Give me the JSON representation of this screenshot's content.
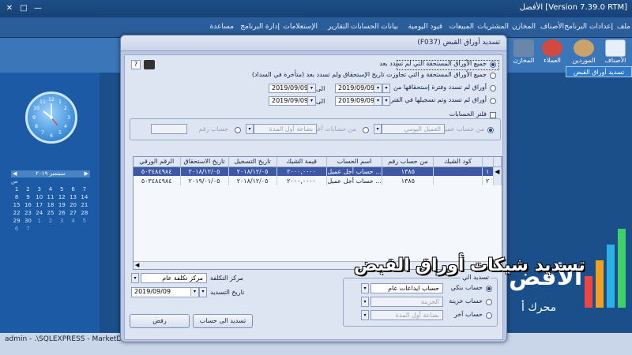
{
  "app": {
    "title": "[Version 7.39.0 RTM] الأفضل",
    "menu": [
      "ملف",
      "إعدادات البرنامج",
      "الأصناف",
      "المخازن",
      "المشتريات",
      "المبيعات",
      "قيود اليومية",
      "بيانات الحسابات",
      "التقارير",
      "الإستعلامات",
      "إدارة البرنامج",
      "مساعدة"
    ],
    "toolbar": [
      "الأصناف",
      "الموردين",
      "العملاء",
      "المخازن"
    ],
    "nav_tab": "تسديد أوراق القبض",
    "status": "admin  -  .\\SQLEXPRESS  -  MarketDB"
  },
  "calendar": {
    "header": "سبتمبر ٢٠١٩",
    "weekday_header": "س",
    "days": [
      "1",
      "2",
      "3",
      "4",
      "5",
      "6",
      "7",
      "8",
      "9",
      "10",
      "11",
      "12",
      "13",
      "14",
      "15",
      "16",
      "17",
      "18",
      "19",
      "20",
      "21",
      "22",
      "23",
      "24",
      "25",
      "26",
      "27",
      "28",
      "29",
      "30",
      "1",
      "2",
      "3",
      "4",
      "5",
      "6",
      "7"
    ]
  },
  "brand": {
    "logo_text": "الأفض",
    "sub_text": "محرك أ"
  },
  "dialog": {
    "title": "تسديد أوراق القبض  (F037)",
    "options": {
      "opt1": "جميع الأوراق المستحقة التي لم تسدد بعد",
      "opt2": "جميع الأوراق المستحقة و التي تجاوزت تاريخ الإستحقاق ولم تسدد بعد (متأخرة في السداد)",
      "opt3": "أوراق لم تسدد وفترة إستحقاقها من",
      "opt4": "أوراق لم تسدد وتم تسجيلها في الفترة من",
      "to_label": "الى",
      "from_date_1": "2019/09/09",
      "to_date_1": "2019/09/09",
      "from_date_2": "2019/09/09",
      "to_date_2": "2019/09/09"
    },
    "filter": {
      "checkbox_label": "فلتر الحسابات",
      "radio_customer": "من حساب عميل",
      "customer_value": "العميل اليومي",
      "radio_other": "من حسابات أخرى",
      "other_value": "بضاعة أول المدة",
      "radio_account_no": "حساب رقم",
      "account_no_value": ""
    },
    "table": {
      "headers": [
        "",
        "",
        "كود الشيك",
        "من حساب رقم",
        "اسم الحساب",
        "قيمة الشيك",
        "تاريخ التسجيل",
        "تاريخ الاستحقاق",
        "الرقم الورقي"
      ],
      "rows": [
        [
          "◀",
          "١",
          "١٣٨٥",
          "حساب أجل عميل ...",
          "٢٠٠٠,٠٠٠٠",
          "٢٠١٨/١٢/٠٥",
          "٢٠١٨/١٢/٠٥",
          "٥٠٣٤٨٤٩٨٤",
          ""
        ],
        [
          "",
          "٢",
          "١٣٨٥",
          "حساب أجل عميل ...",
          "٢٠٠٠,٠٠٠٠",
          "٢٠١٨/١٢/٠٥",
          "٢٠١٩/٠١/٠٥",
          "٥٠٣٤٨٤٩٨٤",
          ""
        ]
      ]
    },
    "overlay_title": "تسديد شيكات أوراق القبض",
    "cost_center_label": "مركز التكلفة",
    "cost_center_value": "مركز تكلفة عام",
    "pay_date_label": "تاريخ التسديد",
    "pay_date_value": "2019/09/09",
    "pay_to": {
      "group_title": "تسديد الي",
      "bank_label": "حساب بنكي",
      "bank_value": "حساب ايداعات عام",
      "cash_label": "حساب خزينة",
      "cash_value": "الخزينة",
      "other_label": "حساب آخر",
      "other_value": "بضاعة أول المدة"
    },
    "buttons": {
      "pay_to_account": "تسديد الى حساب",
      "refuse": "رفض"
    }
  }
}
